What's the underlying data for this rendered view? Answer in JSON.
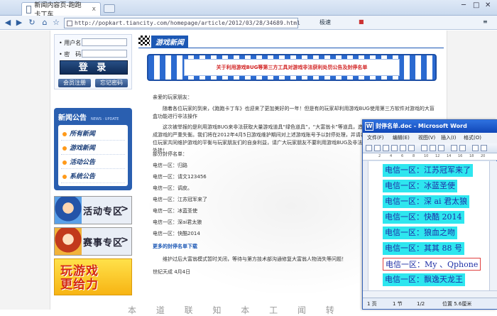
{
  "browser": {
    "tab_title": "新闻内容页-跑跑卡丁车",
    "tab_close": "x",
    "url": "http://popkart.tiancity.com/homepage/article/2012/03/28/34689.html",
    "toolbar_speed": "极速",
    "window_controls": [
      "─",
      "□",
      "✕"
    ]
  },
  "login": {
    "username_label": "• 用户名：",
    "password_label": "• 密　码：",
    "login_button": "登 录",
    "register_button": "会员注册",
    "forgot_button": "忘记密码"
  },
  "announcements": {
    "title": "新闻公告",
    "subtitle": "NEWS · UPDATE",
    "items": [
      "所有新闻",
      "游戏新闻",
      "活动公告",
      "系统公告"
    ]
  },
  "zones": {
    "activity": "活动专区",
    "competition": "赛事专区",
    "arrow": ">"
  },
  "promo": {
    "text_line1": "玩游戏",
    "text_line2": "更给力"
  },
  "news": {
    "section_title": "游戏新闻",
    "banner_title": "关于利用游戏BUG等第三方工具对游戏非法获利处罚公告及封停名单",
    "greeting": "亲爱的玩家朋友：",
    "para1": "随着各位玩家的到来，《跑跑卡丁车》也迎来了更加美好的一年！但是有的玩家却利用游戏BUG使用第三方软件对游戏的大盲盒功能进行非法操作",
    "para2": "这次被举报的是利用游戏BUG来非法获取大量游戏道具“绿色道具”，“大富翁卡”等道具，造成游戏的严重失衡。我们将在2012年4月5日游戏维护期间对上述游戏账号予以封停处理，并请各位玩家共同维护游戏的平衡与玩家朋友们的自身利益，请广大玩家朋友不要利用游戏BUG及非法外挂！",
    "list_title": "部分封停名单：",
    "list": [
      "电信一区：归路",
      "电信一区：请文123456",
      "电信一区：调皮。",
      "电信一区：江苏冠军来了",
      "电信一区：冰蓝圣使",
      "电信一区：深ai君太狼",
      "电信一区：快酷2014"
    ],
    "more_link": "更多的封停名单下载",
    "closing": "维护过后大富翁模式暂时关闭，等待与第方技术部沟通修复大富翁人物消失等问题！",
    "signature": "世纪天成 4月4日",
    "bottom_text": "本 道 联 知 本 工 闻 转"
  },
  "word": {
    "title": "封停名单.doc - Microsoft Word",
    "menu": [
      "文件(F)",
      "编辑(E)",
      "视图(V)",
      "插入(I)",
      "格式(O)"
    ],
    "ruler": [
      "2",
      "4",
      "6",
      "8",
      "10",
      "12",
      "14",
      "16",
      "18",
      "20"
    ],
    "lines": [
      "电信一区：江苏冠军来了",
      "电信一区：冰蓝圣使",
      "电信一区：深 ai 君太狼",
      "电信一区：快酷 2014",
      "电信一区：狼血之吻",
      "电信一区：其其 88 号",
      "电信一区：My 、Qphone",
      "电信一区：飘逸天龙王"
    ],
    "status": [
      "1 页",
      "1 节",
      "1/2",
      "位置 5.6厘米"
    ]
  }
}
